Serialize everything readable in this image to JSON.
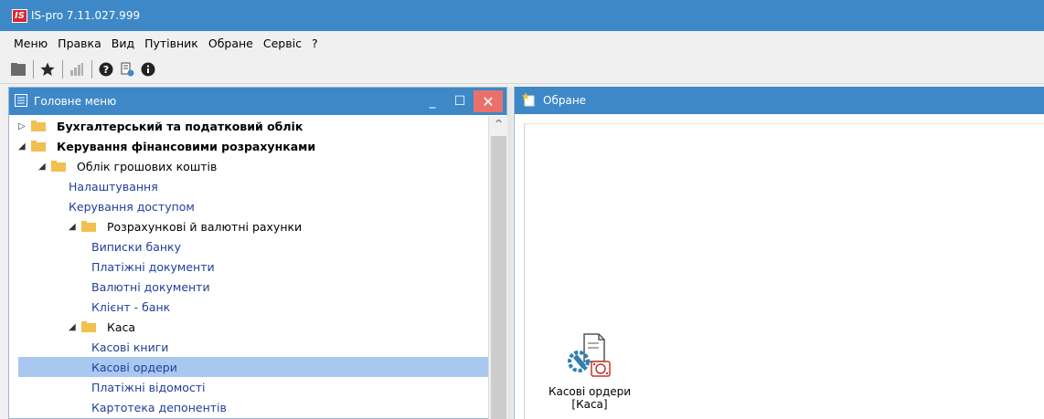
{
  "app": {
    "logo_text": "IS",
    "window_title": "IS-pro 7.11.027.999"
  },
  "menubar": {
    "items": [
      "Меню",
      "Правка",
      "Вид",
      "Путівник",
      "Обране",
      "Сервіс",
      "?"
    ]
  },
  "toolbar": {
    "icons": [
      "folder-icon",
      "star-icon",
      "chart-icon",
      "help-icon",
      "document-info-icon",
      "info-icon"
    ]
  },
  "left_panel": {
    "title": "Головне меню",
    "minimize": "_",
    "maximize": "☐",
    "close": "✕",
    "tree": [
      {
        "label": "Бухгалтерський та податковий облік",
        "level": 0,
        "toggle": "▷",
        "folder": true,
        "bold": true,
        "link": false,
        "selected": false
      },
      {
        "label": "Керування фінансовими розрахунками",
        "level": 0,
        "toggle": "◢",
        "folder": true,
        "bold": true,
        "link": false,
        "selected": false
      },
      {
        "label": "Облік грошових коштів",
        "level": 1,
        "toggle": "◢",
        "folder": true,
        "bold": false,
        "link": false,
        "selected": false
      },
      {
        "label": "Налаштування",
        "level": 2,
        "toggle": "",
        "folder": false,
        "bold": false,
        "link": true,
        "selected": false
      },
      {
        "label": "Керування доступом",
        "level": 2,
        "toggle": "",
        "folder": false,
        "bold": false,
        "link": true,
        "selected": false
      },
      {
        "label": "Розрахункові й валютні рахунки",
        "level": 2,
        "toggle": "◢",
        "folder": true,
        "bold": false,
        "link": false,
        "selected": false
      },
      {
        "label": "Виписки банку",
        "level": 3,
        "toggle": "",
        "folder": false,
        "bold": false,
        "link": true,
        "selected": false
      },
      {
        "label": "Платіжні документи",
        "level": 3,
        "toggle": "",
        "folder": false,
        "bold": false,
        "link": true,
        "selected": false
      },
      {
        "label": "Валютні документи",
        "level": 3,
        "toggle": "",
        "folder": false,
        "bold": false,
        "link": true,
        "selected": false
      },
      {
        "label": "Клієнт - банк",
        "level": 3,
        "toggle": "",
        "folder": false,
        "bold": false,
        "link": true,
        "selected": false
      },
      {
        "label": "Каса",
        "level": 2,
        "toggle": "◢",
        "folder": true,
        "bold": false,
        "link": false,
        "selected": false
      },
      {
        "label": "Касові книги",
        "level": 3,
        "toggle": "",
        "folder": false,
        "bold": false,
        "link": true,
        "selected": false
      },
      {
        "label": "Касові ордери",
        "level": 3,
        "toggle": "",
        "folder": false,
        "bold": false,
        "link": true,
        "selected": true
      },
      {
        "label": "Платіжні відомості",
        "level": 3,
        "toggle": "",
        "folder": false,
        "bold": false,
        "link": true,
        "selected": false
      },
      {
        "label": "Картотека депонентів",
        "level": 3,
        "toggle": "",
        "folder": false,
        "bold": false,
        "link": true,
        "selected": false
      }
    ],
    "scroll_up": "^"
  },
  "right_panel": {
    "title": "Обране",
    "shortcut": {
      "line1": "Касові ордери",
      "line2": "[Каса]",
      "icon": "cash-orders-icon"
    }
  },
  "colors": {
    "titlebar": "#3e88c7",
    "selection": "#a8c8f0",
    "close_button": "#e9716c",
    "folder": "#f0c050",
    "link_text": "#1f3f9a"
  }
}
